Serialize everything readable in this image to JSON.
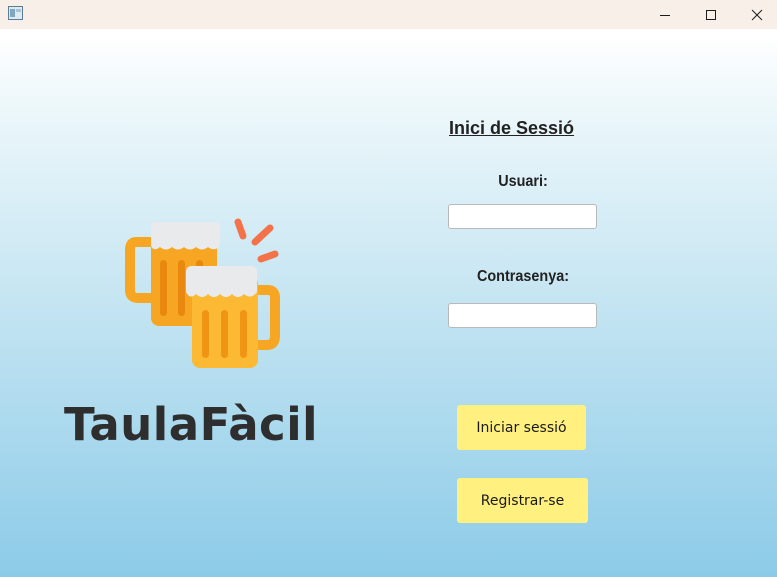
{
  "window": {
    "controls": [
      "minimize",
      "maximize",
      "close"
    ]
  },
  "branding": {
    "logo_icon": "beer-mugs-clinking",
    "app_name": "TaulaFàcil"
  },
  "login": {
    "heading": "Inici de Sessió",
    "username_label": "Usuari:",
    "username_value": "",
    "password_label": "Contrasenya:",
    "password_value": "",
    "login_button": "Iniciar sessió",
    "register_button": "Registrar-se"
  },
  "colors": {
    "button_bg": "#fff07f",
    "title_text": "#2e2e2e",
    "beer_orange": "#f6a623",
    "foam": "#e9eaec",
    "accent_lines": "#f4724a"
  }
}
